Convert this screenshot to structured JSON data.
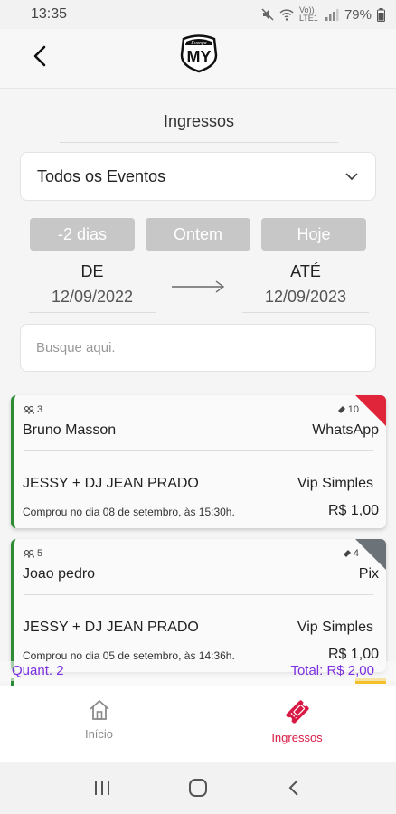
{
  "status": {
    "time": "13:35",
    "net": "Vo)) LTE1",
    "battery": "79%"
  },
  "header": {
    "logo_text": "MY",
    "logo_tag": "Evengo"
  },
  "page": {
    "title": "Ingressos"
  },
  "filter": {
    "event_select": "Todos os Eventos",
    "chips": [
      "-2 dias",
      "Ontem",
      "Hoje"
    ],
    "from_label": "DE",
    "from_date": "12/09/2022",
    "to_label": "ATÉ",
    "to_date": "12/09/2023",
    "search_placeholder": "Busque aqui."
  },
  "tickets": [
    {
      "quantity": "3",
      "tickets": "10",
      "customer": "Bruno Masson",
      "payment": "WhatsApp",
      "event": "JESSY + DJ JEAN PRADO",
      "ticket_type": "Vip Simples",
      "purchased": "Comprou no dia 08 de setembro, às 15:30h.",
      "price": "R$ 1,00",
      "flag_color": "#e0253a"
    },
    {
      "quantity": "5",
      "tickets": "4",
      "customer": "Joao pedro",
      "payment": "Pix",
      "event": "JESSY + DJ JEAN PRADO",
      "ticket_type": "Vip Simples",
      "purchased": "Comprou no dia 05 de setembro, às 14:36h.",
      "price": "R$ 1,00",
      "flag_color": "#6b7378"
    }
  ],
  "totals": {
    "quantity": "Quant. 2",
    "value": "Total: R$ 2,00"
  },
  "nav": {
    "home_label": "Início",
    "tickets_label": "Ingressos",
    "active_color": "#d81b45",
    "inactive_color": "#8a8a8a"
  }
}
